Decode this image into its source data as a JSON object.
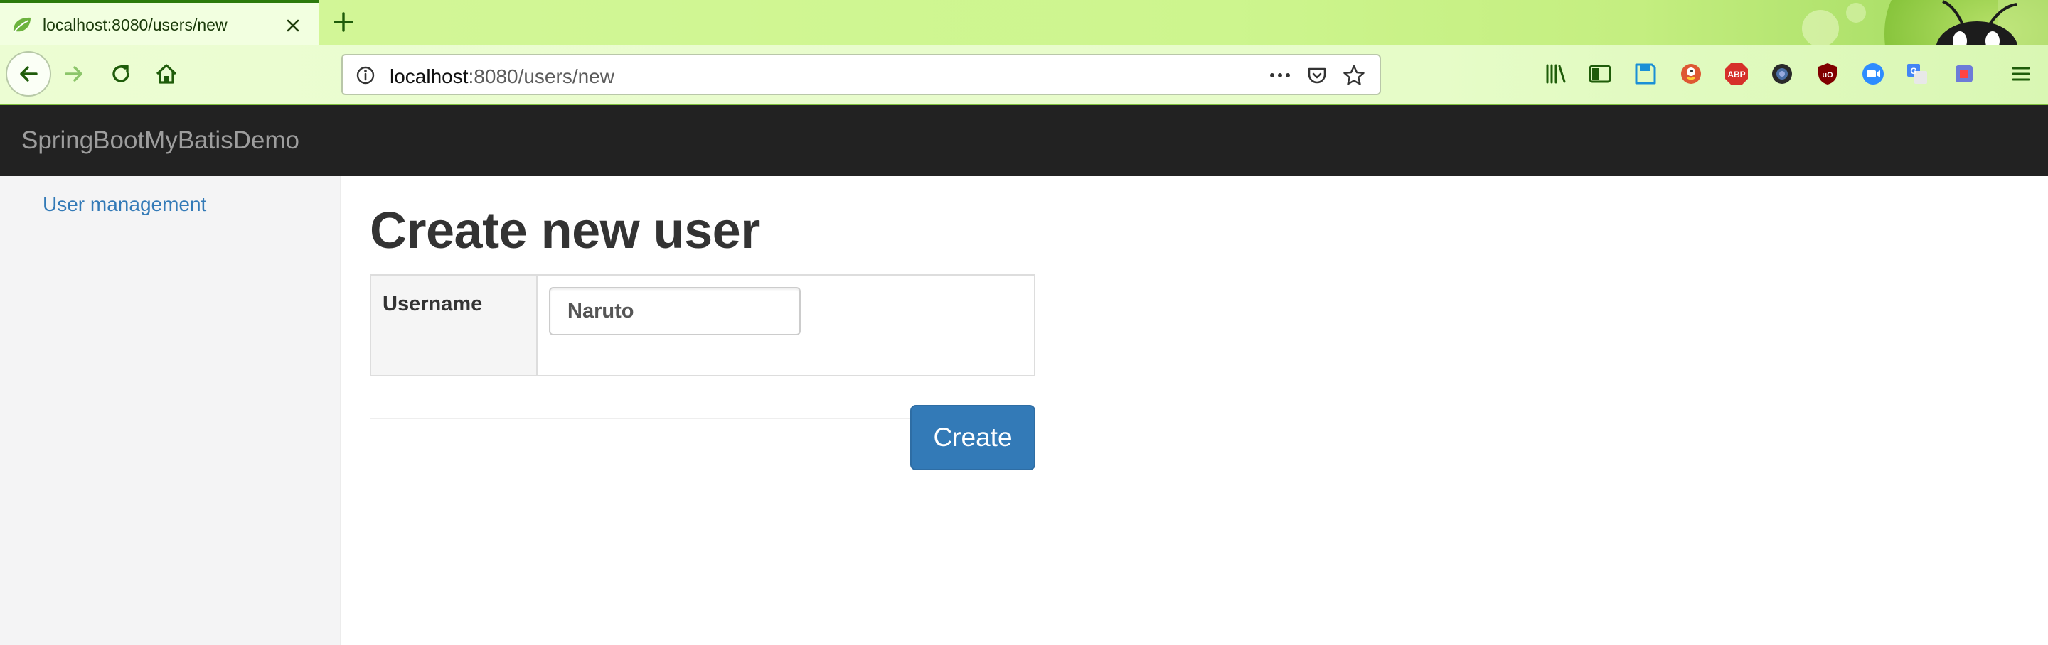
{
  "browser": {
    "tab_title": "localhost:8080/users/new",
    "url_host": "localhost",
    "url_path": ":8080/users/new",
    "accent_color": "#2b7a0b",
    "toolbar_icons": [
      "library-icon",
      "sidebar-icon",
      "save-icon",
      "duckduckgo-icon",
      "adblock-plus-icon",
      "lens-icon",
      "ublock-icon",
      "zoom-icon",
      "translate-icon",
      "menu-icon"
    ],
    "adblock_badge": "ABP"
  },
  "app": {
    "brand": "SpringBootMyBatisDemo",
    "header_color": "#222222"
  },
  "sidebar": {
    "items": [
      {
        "label": "User management"
      }
    ]
  },
  "main": {
    "title": "Create new user",
    "form": {
      "username_label": "Username",
      "username_value": "Naruto"
    },
    "create_label": "Create",
    "primary_color": "#337ab7"
  }
}
